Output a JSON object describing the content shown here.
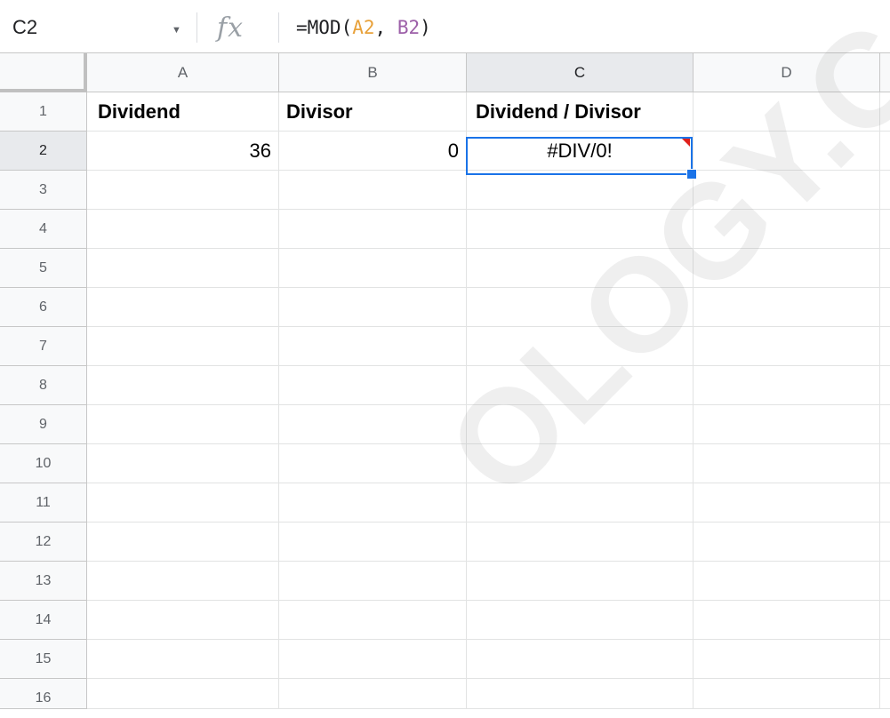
{
  "formula_bar": {
    "name_box": "C2",
    "fx_icon": "fx",
    "formula_prefix": "=MOD(",
    "formula_ref_a": "A2",
    "formula_sep": ", ",
    "formula_ref_b": "B2",
    "formula_suffix": ")"
  },
  "columns": [
    "A",
    "B",
    "C",
    "D"
  ],
  "active_column": "C",
  "rows": [
    "1",
    "2",
    "3",
    "4",
    "5",
    "6",
    "7",
    "8",
    "9",
    "10",
    "11",
    "12",
    "13",
    "14",
    "15",
    "16"
  ],
  "active_row": "2",
  "cells": {
    "A1": "Dividend",
    "B1": "Divisor",
    "C1": "Dividend / Divisor",
    "A2": "36",
    "B2": "0",
    "C2": "#DIV/0!"
  },
  "watermark": "OLOGY.C",
  "colors": {
    "selection": "#1a73e8",
    "error_indicator": "#e0201b",
    "ref_a": "#e8a13a",
    "ref_b": "#9c5fa8"
  }
}
